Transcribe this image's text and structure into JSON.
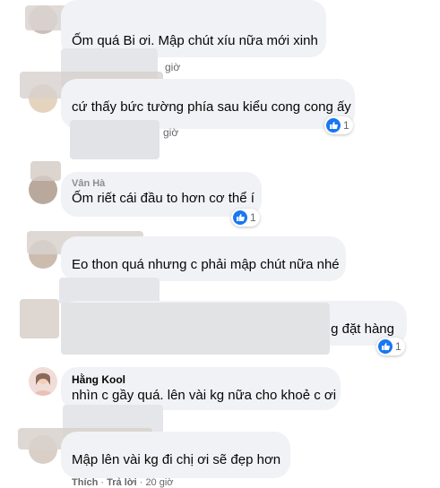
{
  "comments": [
    {
      "author": "",
      "text": "Ốm quá Bi ơi. Mập chút xíu nữa mới xinh",
      "time": "giờ",
      "reactions": ""
    },
    {
      "author": "",
      "text": "cứ thấy bức tường phía sau kiểu cong cong ấy",
      "time": "giờ",
      "reactions": "1"
    },
    {
      "author": "Vân Hà",
      "text": "Ốm riết cái đầu to hơn cơ thể í",
      "time": "",
      "reactions": "1"
    },
    {
      "author": "",
      "text": "Eo thon quá nhưng c phải mập chút nữa nhé",
      "time": "",
      "reactions": ""
    },
    {
      "author": "",
      "text": "g đặt hàng",
      "time": "",
      "reactions": "1"
    },
    {
      "author": "Hằng Kool",
      "text": "nhìn c gầy quá. lên vài kg nữa cho khoẻ c ơi",
      "time": "",
      "reactions": ""
    },
    {
      "author": "",
      "text": "Mập lên vài kg đi chị ơi sẽ đẹp hơn",
      "time": "",
      "reactions": ""
    }
  ],
  "actions": {
    "like": "Thích",
    "reply": "Trả lời",
    "time": "20 giờ"
  },
  "colors": {
    "bubble": "#f0f2f5",
    "like_blue": "#1877f2",
    "meta": "#65676b"
  },
  "icons": {
    "reaction": "thumbs-up-icon"
  }
}
